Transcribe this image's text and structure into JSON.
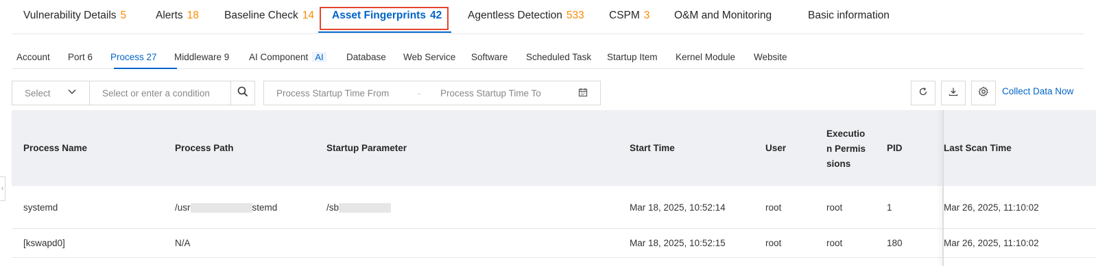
{
  "top_tabs": [
    {
      "label": "Vulnerability Details",
      "count": "5"
    },
    {
      "label": "Alerts",
      "count": "18"
    },
    {
      "label": "Baseline Check",
      "count": "14"
    },
    {
      "label": "Asset Fingerprints",
      "count": "42"
    },
    {
      "label": "Agentless Detection",
      "count": "533"
    },
    {
      "label": "CSPM",
      "count": "3"
    },
    {
      "label": "O&M and Monitoring",
      "count": ""
    },
    {
      "label": "Basic information",
      "count": ""
    }
  ],
  "sub_tabs": [
    {
      "label": "Account"
    },
    {
      "label": "Port 6"
    },
    {
      "label": "Process 27"
    },
    {
      "label": "Middleware 9"
    },
    {
      "label": "AI Component",
      "badge": "AI"
    },
    {
      "label": "Database"
    },
    {
      "label": "Web Service"
    },
    {
      "label": "Software"
    },
    {
      "label": "Scheduled Task"
    },
    {
      "label": "Startup Item"
    },
    {
      "label": "Kernel Module"
    },
    {
      "label": "Website"
    }
  ],
  "filter": {
    "select_value": "Select",
    "condition_placeholder": "Select or enter a condition",
    "date_from_placeholder": "Process Startup Time From",
    "date_separator": "-",
    "date_to_placeholder": "Process Startup Time To",
    "collect_label": "Collect Data Now"
  },
  "table": {
    "columns": [
      "Process Name",
      "Process Path",
      "Startup Parameter",
      "Start Time",
      "User",
      "Execution Permissions",
      "PID",
      "Last Scan Time"
    ],
    "exec_header_lines": [
      "Executio",
      "n Permis",
      "sions"
    ],
    "rows": [
      {
        "name": "systemd",
        "path_prefix": "/usr",
        "path_suffix": "stemd",
        "param_prefix": "/sb",
        "start_time": "Mar 18, 2025, 10:52:14",
        "user": "root",
        "exec": "root",
        "pid": "1",
        "scan_time": "Mar 26, 2025, 11:10:02"
      },
      {
        "name": "[kswapd0]",
        "path_prefix": "N/A",
        "path_suffix": "",
        "param_prefix": "",
        "start_time": "Mar 18, 2025, 10:52:15",
        "user": "root",
        "exec": "root",
        "pid": "180",
        "scan_time": "Mar 26, 2025, 11:10:02"
      }
    ]
  },
  "colors": {
    "accent": "#0064c8",
    "count": "#ff8a00",
    "highlight_box": "#e4452f",
    "header_bg": "#eef0f3"
  },
  "icons": [
    "chevron-down-icon",
    "search-icon",
    "calendar-icon",
    "refresh-icon",
    "download-icon",
    "gear-icon",
    "collapse-icon"
  ]
}
